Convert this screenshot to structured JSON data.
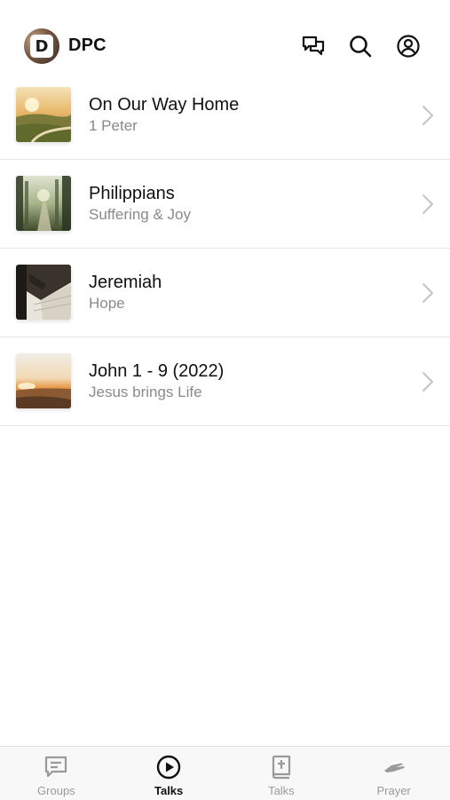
{
  "header": {
    "logo_letter": "D",
    "title": "DPC",
    "icons": [
      "chat-icon",
      "search-icon",
      "account-icon"
    ]
  },
  "talks": [
    {
      "title": "On Our Way Home",
      "subtitle": "1 Peter"
    },
    {
      "title": "Philippians",
      "subtitle": "Suffering & Joy"
    },
    {
      "title": "Jeremiah",
      "subtitle": "Hope"
    },
    {
      "title": "John 1 - 9 (2022)",
      "subtitle": "Jesus brings Life"
    }
  ],
  "tabbar": {
    "tabs": [
      {
        "label": "Groups",
        "icon": "message-square-icon",
        "active": false
      },
      {
        "label": "Talks",
        "icon": "play-circle-icon",
        "active": true
      },
      {
        "label": "Talks",
        "icon": "bible-icon",
        "active": false
      },
      {
        "label": "Prayer",
        "icon": "praying-hands-icon",
        "active": false
      }
    ]
  },
  "colors": {
    "text_primary": "#111111",
    "text_secondary": "#8a8a8a",
    "tab_inactive": "#9a9a9a",
    "divider": "#e6e6e6"
  }
}
